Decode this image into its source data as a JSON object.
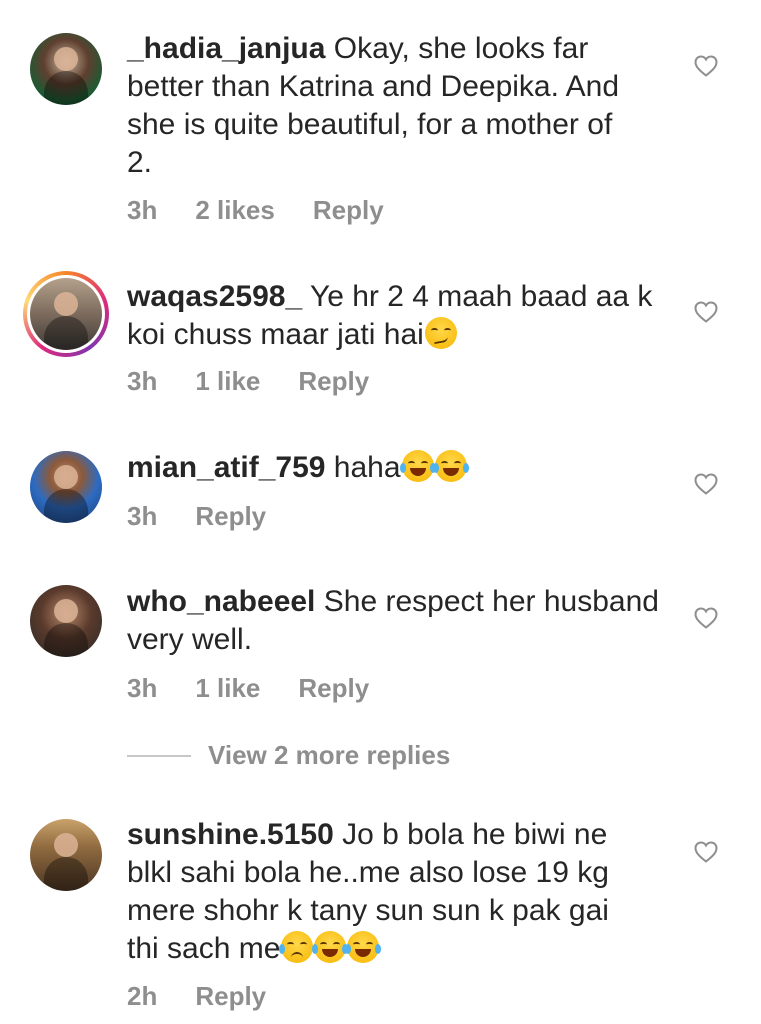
{
  "comments": [
    {
      "username": "_hadia_janjua",
      "text_lines": [
        "Okay, she looks far",
        "better than Katrina and Deepika. And",
        "she is quite beautiful, for a mother of",
        "2."
      ],
      "time": "3h",
      "likes": "2 likes",
      "reply": "Reply"
    },
    {
      "username": "waqas2598_",
      "text_lines": [
        "Ye hr 2 4 maah baad aa k",
        "koi chuss maar jati hai"
      ],
      "time": "3h",
      "likes": "1 like",
      "reply": "Reply",
      "emojis": [
        "smirking-face"
      ],
      "has_story_ring": true
    },
    {
      "username": "mian_atif_759",
      "text_lines": [
        "haha"
      ],
      "time": "3h",
      "reply": "Reply",
      "emojis": [
        "face-with-tears-of-joy",
        "face-with-tears-of-joy"
      ]
    },
    {
      "username": "who_nabeeel",
      "text_lines": [
        "She respect her husband",
        "very well."
      ],
      "time": "3h",
      "likes": "1 like",
      "reply": "Reply"
    },
    {
      "username": "sunshine.5150",
      "text_lines": [
        "Jo b bola he biwi ne",
        "blkl sahi bola he..me also lose 19 kg",
        "mere shohr k tany sun sun k pak gai",
        "thi sach me"
      ],
      "time": "2h",
      "reply": "Reply",
      "emojis": [
        "crying-face",
        "face-with-tears-of-joy",
        "face-with-tears-of-joy"
      ]
    }
  ],
  "view_more_replies": "View 2 more replies",
  "colors": {
    "text": "#262626",
    "meta": "#8e8e8e",
    "divider": "#c7c7c7"
  },
  "icons": {
    "like": "heart-outline-icon"
  }
}
